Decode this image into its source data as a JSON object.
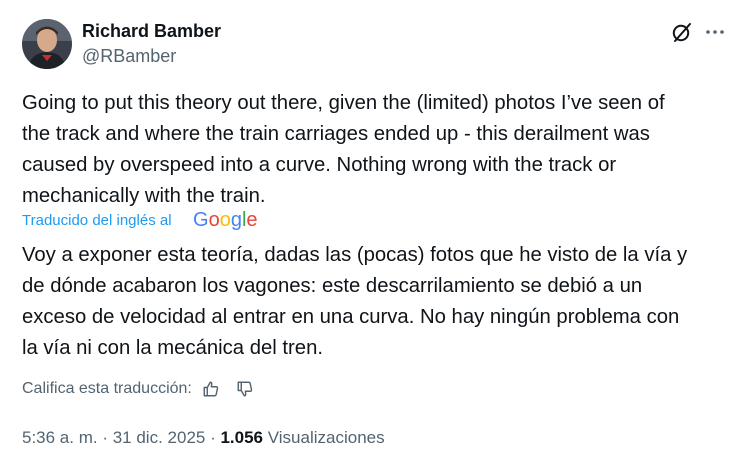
{
  "author": {
    "display_name": "Richard Bamber",
    "handle": "@RBamber",
    "avatar_icon": "profile-photo"
  },
  "header_icons": [
    "grok-icon",
    "more-options-icon"
  ],
  "tweet": {
    "text_lines": [
      "Going to put this theory out there, given the (limited) photos I’ve seen of",
      "the track and where the train carriages ended up - this derailment was",
      "caused by overspeed into a curve. Nothing wrong with the track or",
      "mechanically with the train."
    ]
  },
  "translation": {
    "label": "Traducido del inglés al",
    "provider": "Google",
    "provider_colors": [
      "#4285F4",
      "#EA4335",
      "#FBBC05",
      "#4285F4",
      "#34A853",
      "#EA4335"
    ],
    "text_lines": [
      "Voy a exponer esta teoría, dadas las (pocas) fotos que he visto de la vía y",
      "de dónde acabaron los vagones: este descarrilamiento se debió a un",
      "exceso de velocidad al entrar en una curva. No hay ningún problema con",
      "la vía ni con la mecánica del tren."
    ],
    "rate_label": "Califica esta traducción:",
    "rate_icons": [
      "thumbs-up-icon",
      "thumbs-down-icon"
    ]
  },
  "meta": {
    "time": "5:36 a. m.",
    "separator": " · ",
    "date": "31 dic. 2025",
    "views_count": "1.056",
    "views_label": "Visualizaciones"
  },
  "colors": {
    "text_primary": "#0f1419",
    "text_secondary": "#536471",
    "link_blue": "#1d9bf0"
  }
}
